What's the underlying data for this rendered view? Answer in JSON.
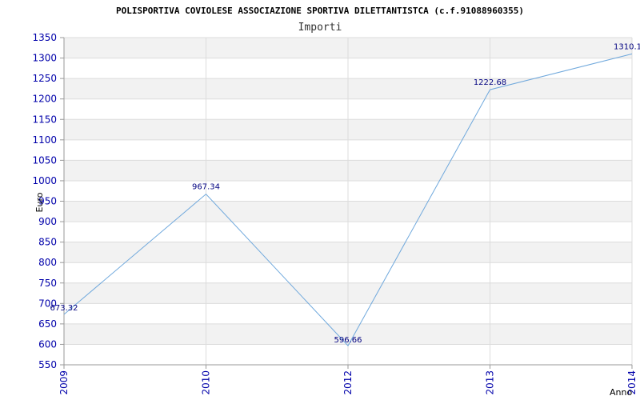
{
  "chart_data": {
    "type": "line",
    "title": "POLISPORTIVA COVIOLESE ASSOCIAZIONE SPORTIVA DILETTANTISTCA (c.f.91088960355)",
    "subtitle": "Importi",
    "xlabel": "Anno",
    "ylabel": "Euro",
    "categories": [
      "2009",
      "2010",
      "2012",
      "2013",
      "2014"
    ],
    "values": [
      673.32,
      967.34,
      596.66,
      1222.68,
      1310.1
    ],
    "value_labels": [
      "673.32",
      "967.34",
      "596.66",
      "1222.68",
      "1310.1"
    ],
    "ylim": [
      550,
      1350
    ],
    "yticks": [
      "550",
      "600",
      "650",
      "700",
      "750",
      "800",
      "850",
      "900",
      "950",
      "1000",
      "1050",
      "1100",
      "1150",
      "1200",
      "1250",
      "1300",
      "1350"
    ],
    "grid": true,
    "colors": {
      "line": "#6fa8dc",
      "band": "#f2f2f2",
      "grid": "#dcdcdc",
      "tick_text": "#0000aa"
    }
  }
}
